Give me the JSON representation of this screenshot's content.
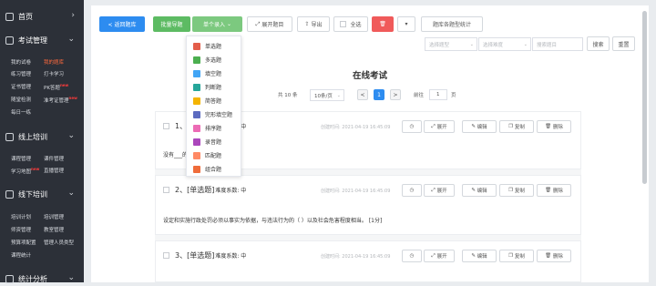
{
  "sidebar": {
    "home": "首页",
    "exam_mgmt": "考试管理",
    "exam_items": [
      [
        "我的试卷",
        "我的题库"
      ],
      [
        "练习管理",
        "打卡学习"
      ],
      [
        "证书管理",
        "PK答题"
      ],
      [
        "随堂检测",
        "准考证管理"
      ],
      [
        "每日一练",
        ""
      ]
    ],
    "new_badge": "new",
    "online": "线上培训",
    "online_items": [
      [
        "课程管理",
        "课件管理"
      ],
      [
        "学习地图",
        "直播管理"
      ]
    ],
    "offline": "线下培训",
    "offline_items": [
      [
        "培训计划",
        "培训管理"
      ],
      [
        "师资管理",
        "教室管理"
      ],
      [
        "预算项配置",
        "管理人员类型"
      ],
      [
        "课程统计",
        ""
      ]
    ],
    "stats": "统计分析"
  },
  "toolbar": {
    "back": "< 返回题库",
    "batch_import": "批量导题",
    "single_import": "单个录入",
    "expand_all": "展开题目",
    "export": "导出",
    "select_all": "全选",
    "more": "▾",
    "stats": "题库各题型统计"
  },
  "filters": {
    "type_placeholder": "选择题型",
    "difficulty_placeholder": "选择难度",
    "search_placeholder": "搜索题目",
    "search_btn": "搜索",
    "reset_btn": "重置"
  },
  "dropdown": {
    "items": [
      "单选题",
      "多选题",
      "填空题",
      "判断题",
      "简答题",
      "完形填空题",
      "排序题",
      "录音题",
      "匹配题",
      "组合题"
    ],
    "colors": [
      "#e35d4a",
      "#4caf50",
      "#42a5f5",
      "#26a69a",
      "#f4b400",
      "#5c6bc0",
      "#ec6bb5",
      "#ab47bc",
      "#ff8a65",
      "#ef6c3a"
    ]
  },
  "page_title": "在线考试",
  "pagination": {
    "total": "共 10 条",
    "per_page": "10条/页",
    "prev": "<",
    "current": "1",
    "next": ">",
    "goto": "前往",
    "page_input": "1",
    "page_unit": "页"
  },
  "questions": [
    {
      "number": "1、",
      "type": "[单选题]",
      "difficulty": "难度系数: 中",
      "date": "创建时间: 2021-04-19 16:45:09",
      "body": "没有___的行政处罚无效。 [1分]"
    },
    {
      "number": "2、",
      "type": "[单选题]",
      "difficulty": "难度系数: 中",
      "date": "创建时间: 2021-04-19 16:45:09",
      "body": "设定和实施行政处罚必须以事实为依据，与违法行为的（ ）以及社会危害程度相当。 [1分]"
    },
    {
      "number": "3、",
      "type": "[单选题]",
      "difficulty": "难度系数: 中",
      "date": "创建时间: 2021-04-19 16:45:09",
      "body": ""
    }
  ],
  "actions": {
    "clock": "◷",
    "expand": "展开",
    "edit": "编辑",
    "copy": "复制",
    "delete": "删除"
  }
}
